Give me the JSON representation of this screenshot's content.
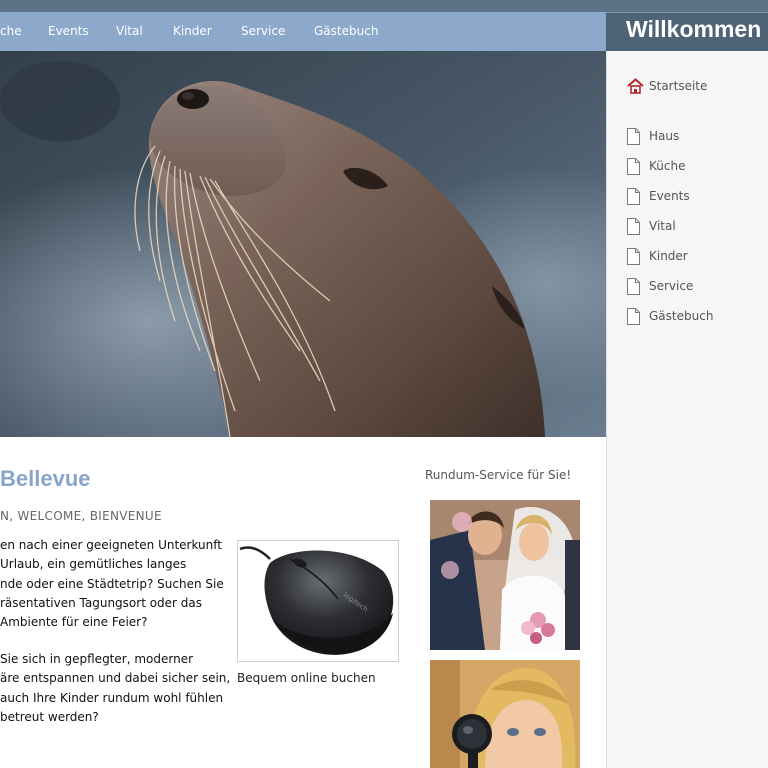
{
  "nav": {
    "items": [
      "che",
      "Events",
      "Vital",
      "Kinder",
      "Service",
      "Gästebuch"
    ]
  },
  "welcome": {
    "title": "Willkommen"
  },
  "sidebar": {
    "home": "Startseite",
    "items": [
      "Haus",
      "Küche",
      "Events",
      "Vital",
      "Kinder",
      "Service",
      "Gästebuch"
    ]
  },
  "main": {
    "heading": "Bellevue",
    "subheading": "N, WELCOME, BIENVENUE",
    "paragraph1": [
      "en nach einer geeigneten Unterkunft",
      " Urlaub, ein gemütliches langes",
      "nde oder eine Städtetrip? Suchen Sie",
      "räsentativen Tagungsort oder das",
      " Ambiente für eine Feier?"
    ],
    "paragraph2": [
      " Sie sich in gepflegter, moderner",
      "äre entspannen und dabei sicher sein,",
      " auch Ihre Kinder rundum wohl fühlen",
      "betreut werden?"
    ],
    "mouse_caption": "Bequem online buchen"
  },
  "service": {
    "title": "Rundum-Service für Sie!"
  },
  "colors": {
    "nav_bg": "#8ca8cb",
    "welcome_bg": "#4f6377",
    "heading": "#88a4c8",
    "sidebar_bg": "#f6f6f7"
  },
  "icons": {
    "home": "house-icon",
    "page": "page-icon"
  }
}
